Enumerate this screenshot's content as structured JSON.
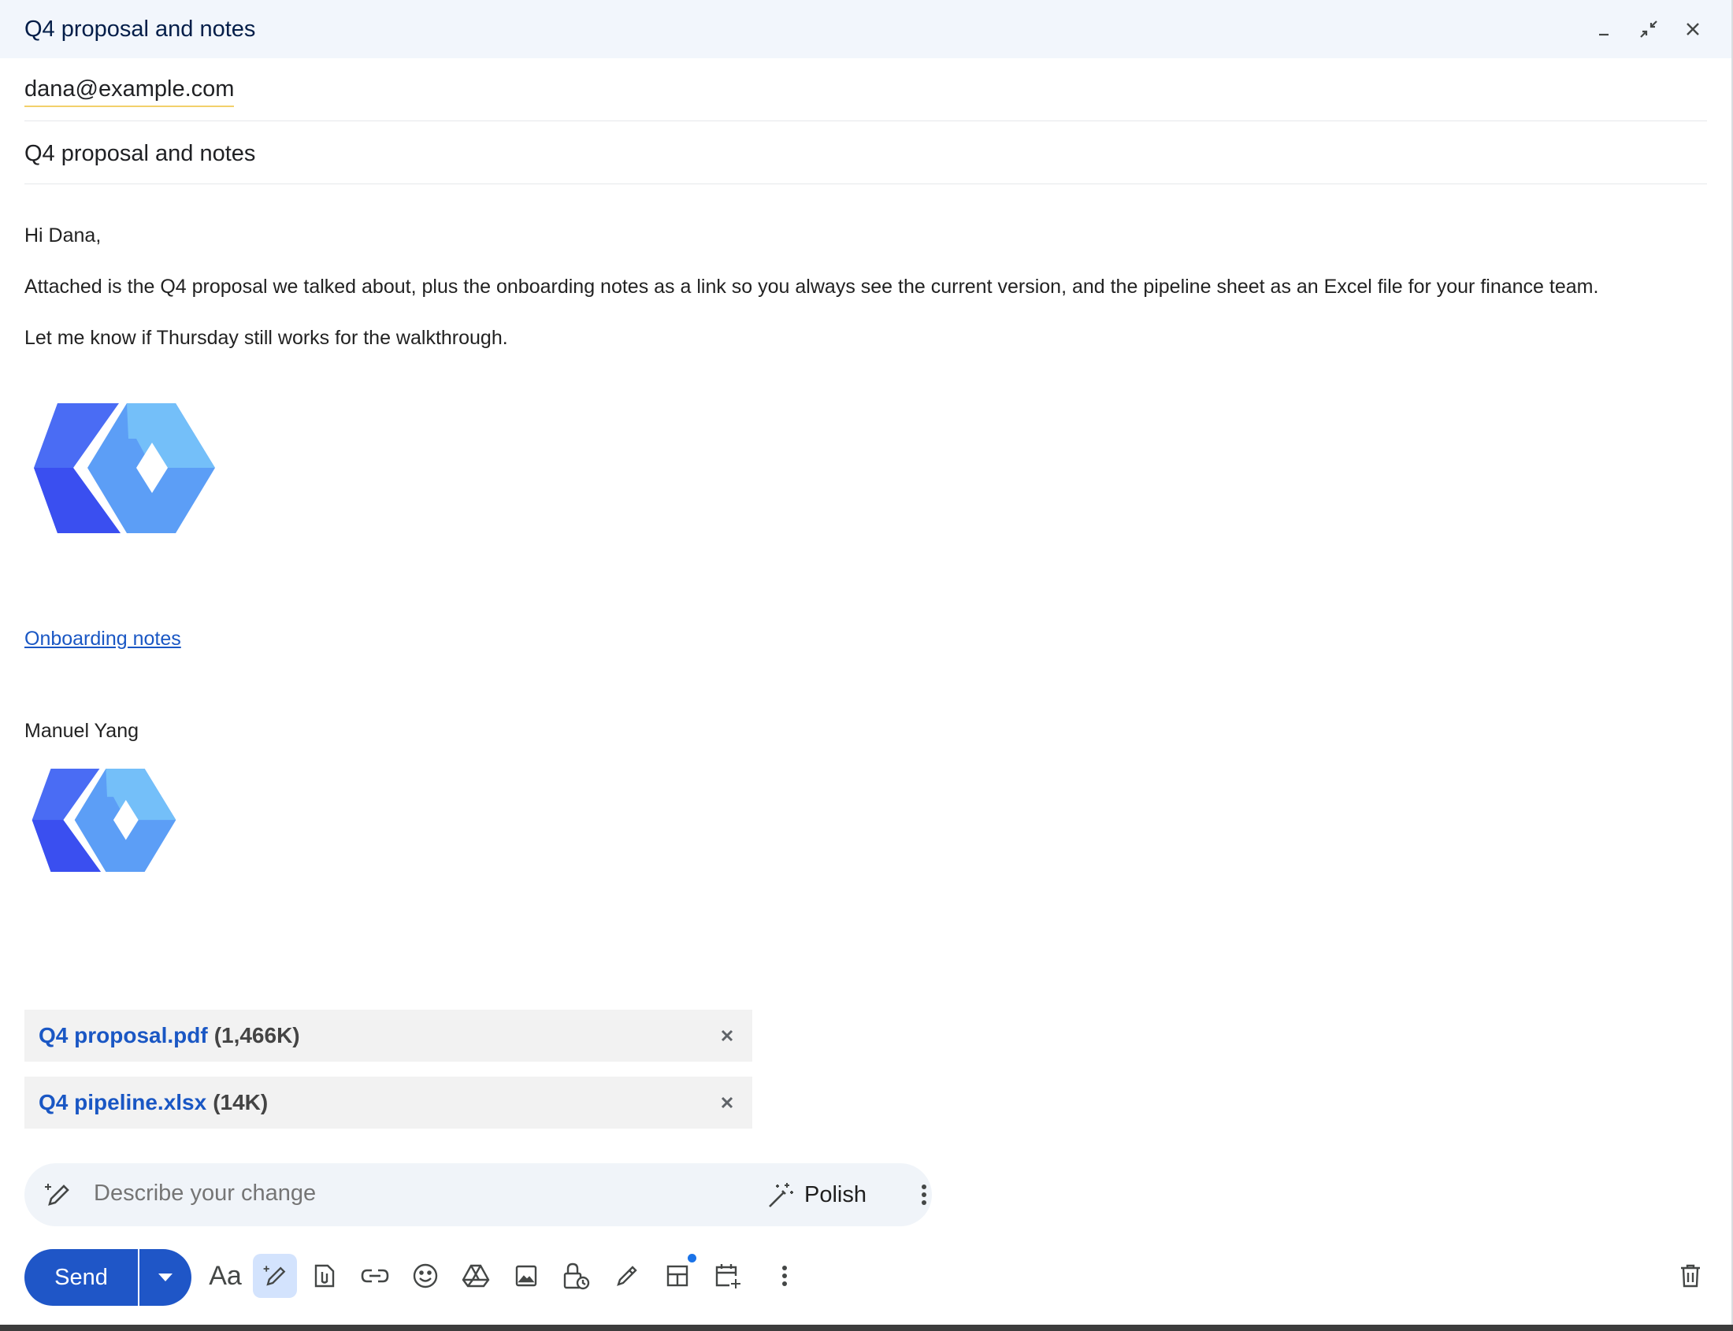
{
  "window": {
    "title": "Q4 proposal and notes",
    "minimize_label": "Minimize",
    "exit_fullscreen_label": "Exit full screen",
    "close_label": "Save & close"
  },
  "recipients": {
    "to": "dana@example.com"
  },
  "subject": "Q4 proposal and notes",
  "message": {
    "greeting": "Hi Dana,",
    "paragraph1": "Attached is the Q4 proposal we talked about, plus the onboarding notes as a link so you always see the current version, and the pipeline sheet as an Excel file for your finance team.",
    "paragraph2": "Let me know if Thursday still works for the walkthrough.",
    "link_text": "Onboarding notes",
    "signature_name": "Manuel Yang"
  },
  "attachments": [
    {
      "name": "Q4 proposal.pdf",
      "size": "(1,466K)"
    },
    {
      "name": "Q4 pipeline.xlsx",
      "size": "(14K)"
    }
  ],
  "polish": {
    "placeholder": "Describe your change",
    "button_label": "Polish"
  },
  "toolbar": {
    "send_label": "Send",
    "format_label": "Aa"
  },
  "colors": {
    "accent": "#1f56c7",
    "link": "#1a57c4",
    "header_bg": "#f2f6fc",
    "logo_dark": "#3b5bf0",
    "logo_light": "#6fb8fa"
  }
}
